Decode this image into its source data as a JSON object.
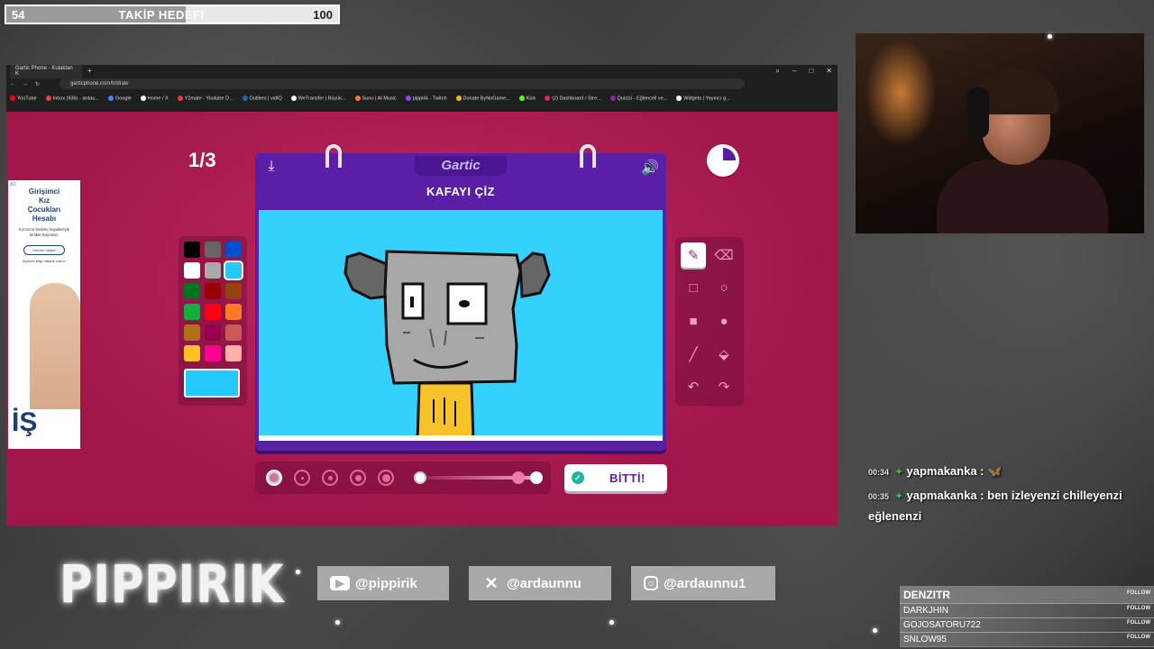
{
  "goal": {
    "start": "54",
    "title": "TAKİP HEDEFİ",
    "end": "100",
    "progress": 0.54
  },
  "browser": {
    "tab_title": "Gartic Phone - Kulaktan K",
    "url": "garticphone.com/tr/draw",
    "bookmarks": [
      {
        "label": "YouTube",
        "color": "#ff0000"
      },
      {
        "label": "Inbox (936) - ardau...",
        "color": "#ea4335"
      },
      {
        "label": "Google",
        "color": "#4285f4"
      },
      {
        "label": "Home / X",
        "color": "#ffffff"
      },
      {
        "label": "Y2mate - Youtube D...",
        "color": "#e53935"
      },
      {
        "label": "Outliers | vidIQ",
        "color": "#1565c0"
      },
      {
        "label": "WeTransfer | Büyük...",
        "color": "#ffffff"
      },
      {
        "label": "Suno | AI Music",
        "color": "#ff7043"
      },
      {
        "label": "pippirik - Twitch",
        "color": "#9146ff"
      },
      {
        "label": "Donate ByNoGame...",
        "color": "#ffb300"
      },
      {
        "label": "Kick",
        "color": "#53fc18"
      },
      {
        "label": "(2) Dashboard / Stre...",
        "color": "#e91e63"
      },
      {
        "label": "Quizizi - Eğlenceli ve...",
        "color": "#8e24aa"
      },
      {
        "label": "Widgets | Yayıncı g...",
        "color": "#ffffff"
      }
    ]
  },
  "ad": {
    "tag": "AD",
    "heading_lines": [
      "Girişimci",
      "Kız",
      "Çocukları",
      "Hesabı"
    ],
    "body": "Kızınızın birikimi hayalleriyle birlikte büyüsün.",
    "button": "Hemen Keşfet",
    "footer": "Ayrıntılı bilgi: isbank.com.tr",
    "logo": "İŞ"
  },
  "game": {
    "round": "1/3",
    "logo": "Gartic",
    "task": "KAFAYI ÇİZ",
    "done_label": "BİTTİ!",
    "palette": [
      "#000000",
      "#666666",
      "#0050cd",
      "#ffffff",
      "#aaaaaa",
      "#26c9ff",
      "#017420",
      "#990000",
      "#964112",
      "#11b03c",
      "#ff0013",
      "#ff7829",
      "#b0701c",
      "#99004e",
      "#cb5a57",
      "#ffc126",
      "#ff008f",
      "#feafa8"
    ],
    "selected_color": "#26c9ff",
    "canvas_bg": "#33d1fb",
    "tools": [
      "pencil-icon",
      "eraser-icon",
      "rectangle-outline-icon",
      "ellipse-outline-icon",
      "rectangle-filled-icon",
      "ellipse-filled-icon",
      "line-icon",
      "fill-bucket-icon",
      "undo-icon",
      "redo-icon"
    ],
    "brush_sizes": 5,
    "selected_brush": 0,
    "opacity": 1.0
  },
  "chat": [
    {
      "time": "00:34",
      "user": "yapmakanka",
      "message": "",
      "emote": "butterfly-emote"
    },
    {
      "time": "00:35",
      "user": "yapmakanka",
      "message": "ben izleyenzi chilleyenzi eğlenenzi"
    }
  ],
  "brand": "PIPPIRIK",
  "socials": [
    {
      "icon": "youtube-icon",
      "handle": "@pippirik"
    },
    {
      "icon": "x-icon",
      "handle": "@ardaunnu"
    },
    {
      "icon": "instagram-icon",
      "handle": "@ardaunnu1"
    }
  ],
  "follows": {
    "tag": "FOLLOW",
    "names": [
      "DENZITR",
      "DARKJHIN",
      "GOJOSATORU722",
      "SNLOW95"
    ]
  }
}
